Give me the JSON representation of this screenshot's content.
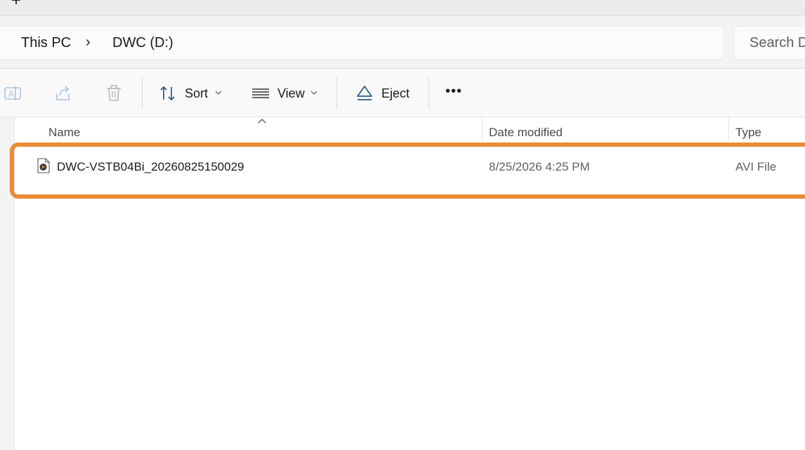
{
  "tabs": {
    "new_tab_glyph": "+"
  },
  "breadcrumb": {
    "items": [
      "This PC",
      "DWC (D:)"
    ],
    "separator": "›"
  },
  "search": {
    "placeholder": "Search D"
  },
  "toolbar": {
    "sort_label": "Sort",
    "view_label": "View",
    "eject_label": "Eject",
    "more_label": "•••",
    "icons": [
      "rename-icon",
      "share-icon",
      "delete-icon",
      "sort-icon",
      "view-icon",
      "eject-icon",
      "more-icon"
    ]
  },
  "columns": {
    "name": "Name",
    "date_modified": "Date modified",
    "type": "Type"
  },
  "files": [
    {
      "name": "DWC-VSTB04Bi_20260825150029",
      "date_modified": "8/25/2026 4:25 PM",
      "type": "AVI File",
      "icon": "video-file-icon"
    }
  ],
  "colors": {
    "highlight": "#e98b35"
  }
}
